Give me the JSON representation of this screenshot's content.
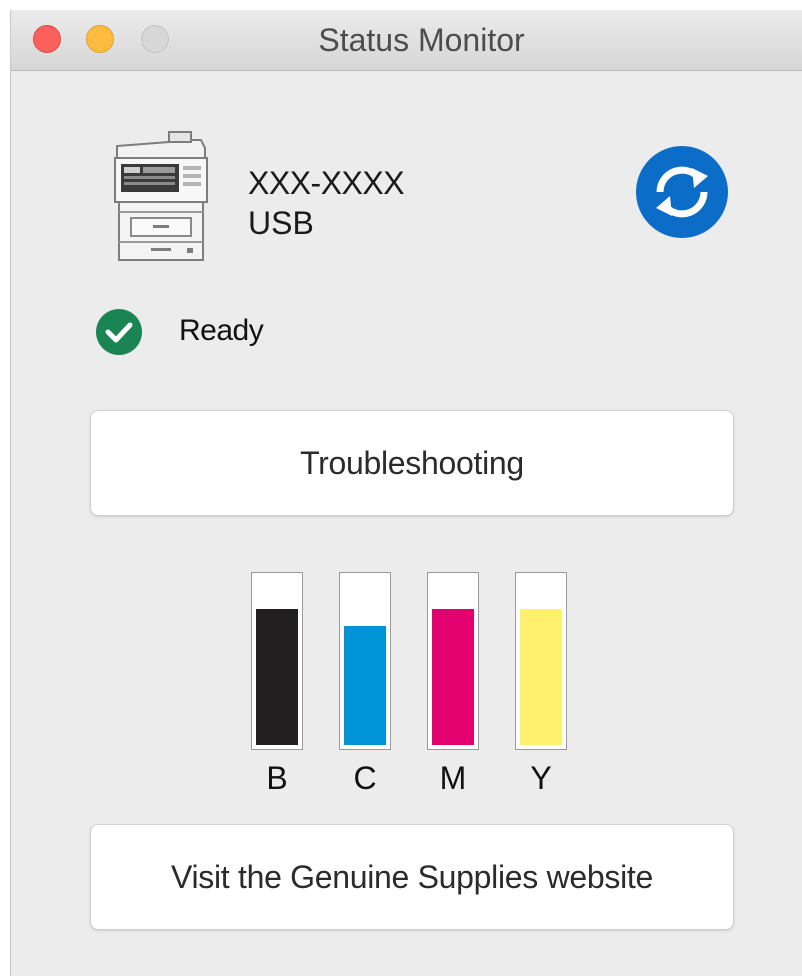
{
  "window": {
    "title": "Status Monitor"
  },
  "device": {
    "model": "XXX-XXXX",
    "connection": "USB",
    "icon": "printer-icon",
    "refresh_icon": "refresh-icon"
  },
  "status": {
    "icon": "check-circle-icon",
    "text": "Ready",
    "color": "#1a8553"
  },
  "buttons": {
    "troubleshooting": "Troubleshooting",
    "supplies": "Visit the Genuine Supplies website"
  },
  "ink_levels": [
    {
      "label": "B",
      "level": 0.81,
      "color": "#231f20"
    },
    {
      "label": "C",
      "level": 0.71,
      "color": "#0093d5"
    },
    {
      "label": "M",
      "level": 0.81,
      "color": "#e3006f"
    },
    {
      "label": "Y",
      "level": 0.81,
      "color": "#fff06e"
    }
  ],
  "colors": {
    "accent": "#0b6dc7",
    "close": "#fc605c",
    "minimize": "#fdbc40",
    "zoom_disabled": "#d7d7d7"
  }
}
